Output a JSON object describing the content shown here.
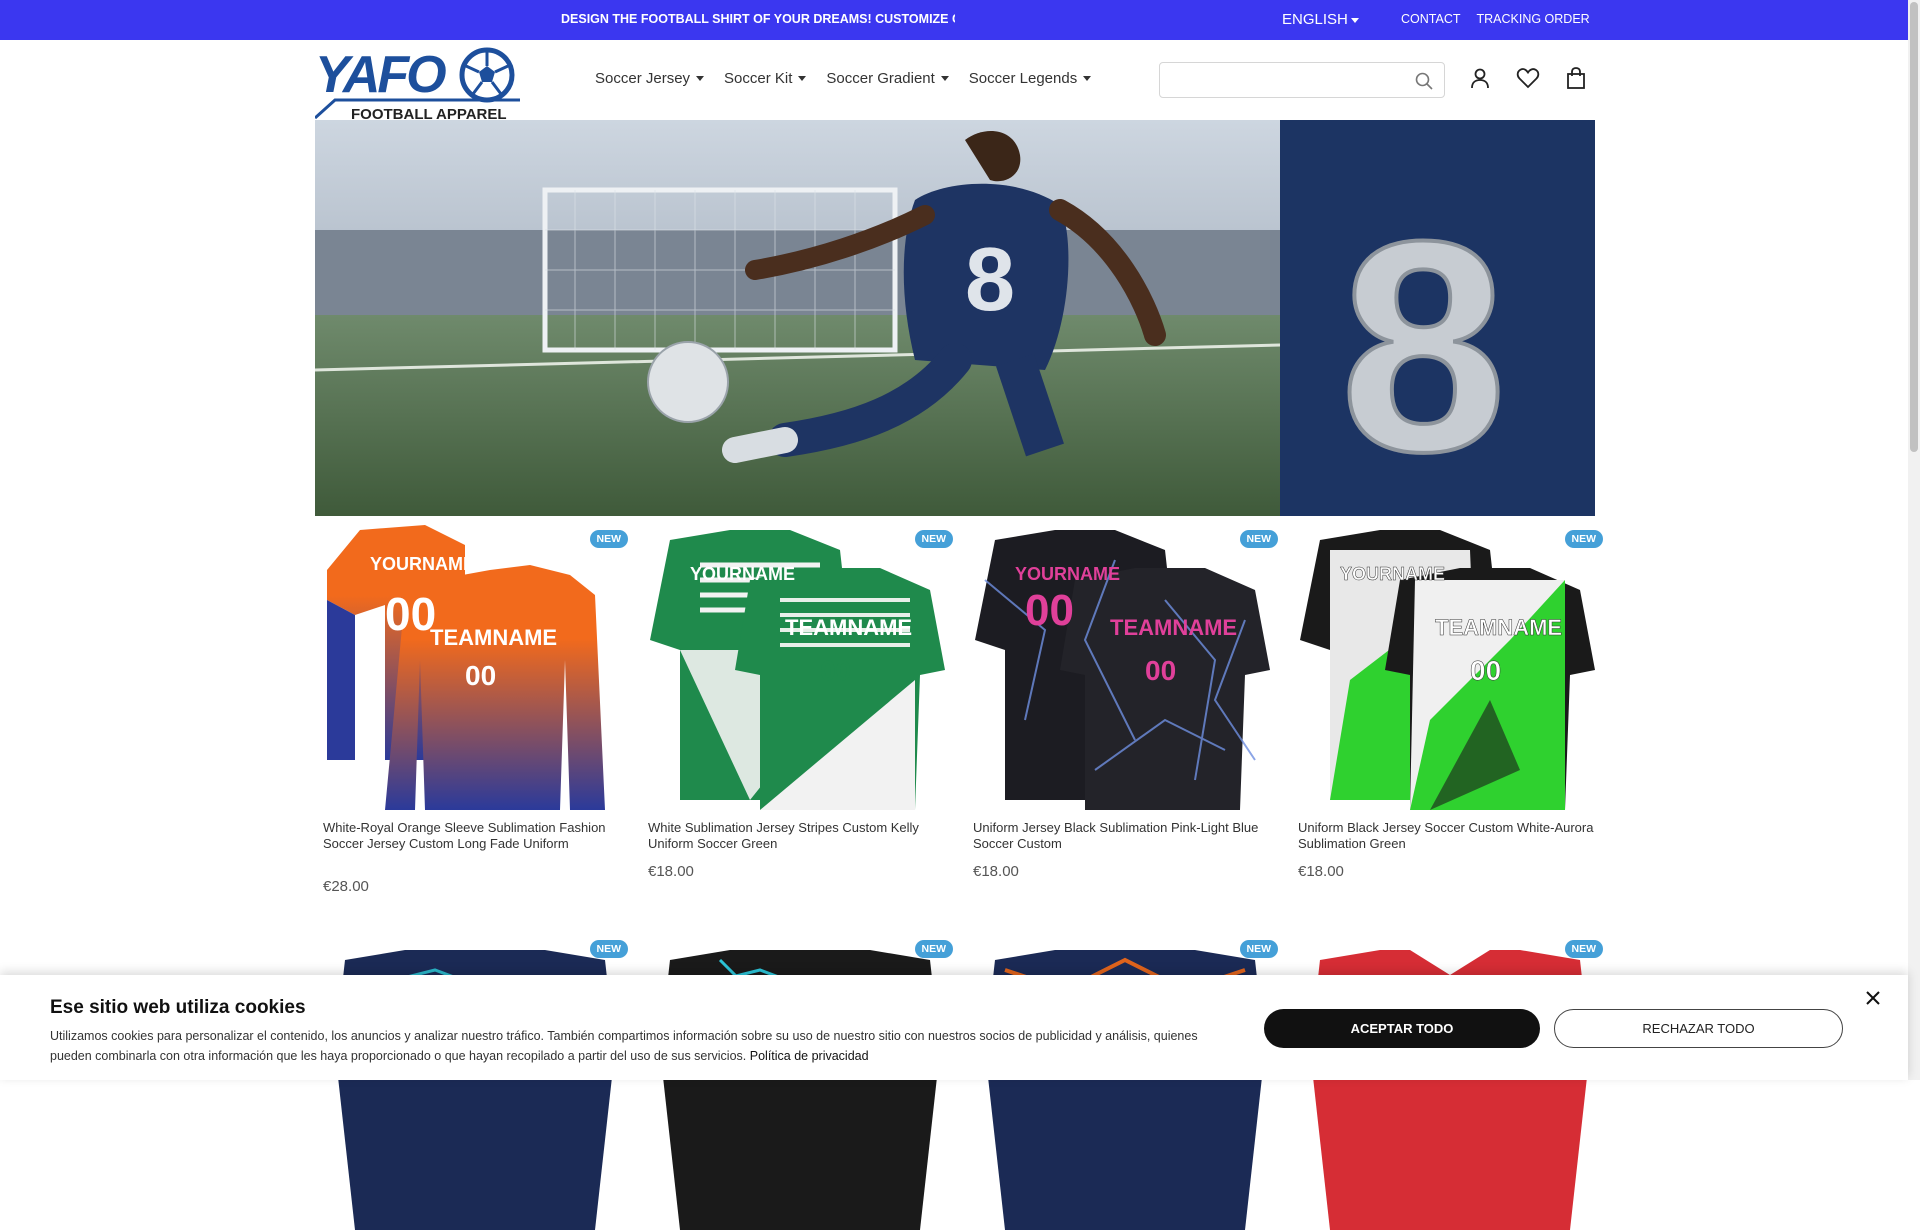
{
  "topbar": {
    "promo": "DESIGN THE FOOTBALL SHIRT OF YOUR DREAMS! CUSTOMIZE COL",
    "language": "ENGLISH",
    "links": [
      "CONTACT",
      "TRACKING ORDER"
    ],
    "color": "#3b37f0"
  },
  "logo": {
    "text_main": "YAFO",
    "text_sub": "FOOTBALL APPAREL"
  },
  "nav": {
    "items": [
      "Soccer Jersey",
      "Soccer Kit",
      "Soccer Gradient",
      "Soccer Legends"
    ]
  },
  "search": {
    "placeholder": "",
    "icon": "search-icon"
  },
  "header_icons": [
    "user-icon",
    "heart-icon",
    "bag-icon"
  ],
  "hero": {
    "jersey_number": "8"
  },
  "products": [
    {
      "badge": "NEW",
      "name": "White-Royal Orange Sleeve Sublimation Fashion Soccer Jersey Custom Long Fade Uniform",
      "price": "€28.00",
      "colors": [
        "#f26a1c",
        "#2b3a9a"
      ],
      "jersey_text": "YOURNAME",
      "team_text": "TEAMNAME",
      "number": "00"
    },
    {
      "badge": "NEW",
      "name": "White Sublimation Jersey Stripes Custom Kelly Uniform Soccer Green",
      "price": "€18.00",
      "colors": [
        "#1f8a4c",
        "#f2f2f2"
      ],
      "jersey_text": "YOURNAME",
      "team_text": "TEAMNAME",
      "number": "00"
    },
    {
      "badge": "NEW",
      "name": "Uniform Jersey Black Sublimation Pink-Light Blue Soccer Custom",
      "price": "€18.00",
      "colors": [
        "#1c1c22",
        "#e0409a"
      ],
      "jersey_text": "YOURNAME",
      "team_text": "TEAMNAME",
      "number": "00"
    },
    {
      "badge": "NEW",
      "name": "Uniform Black Jersey Soccer Custom White-Aurora Sublimation Green",
      "price": "€18.00",
      "colors": [
        "#1a1a1a",
        "#2fd12f"
      ],
      "jersey_text": "YOURNAME",
      "team_text": "TEAMNAME",
      "number": "00"
    },
    {
      "badge": "NEW",
      "colors": [
        "#1b2a55",
        "#2bb6c9"
      ]
    },
    {
      "badge": "NEW",
      "colors": [
        "#1a1a1a",
        "#2cc4d8"
      ]
    },
    {
      "badge": "NEW",
      "colors": [
        "#1b2a55",
        "#e0641c"
      ]
    },
    {
      "badge": "NEW",
      "colors": [
        "#d62d35",
        "#ffffff"
      ]
    }
  ],
  "cookie": {
    "title": "Ese sitio web utiliza cookies",
    "text": "Utilizamos cookies para personalizar el contenido, los anuncios y analizar nuestro tráfico. También compartimos información sobre su uso de nuestro sitio con nuestros socios de publicidad y análisis, quienes pueden combinarla con otra información que les haya proporcionado o que hayan recopilado a partir del uso de sus servicios.",
    "privacy_link": "Política de privacidad",
    "accept": "ACEPTAR TODO",
    "reject": "RECHAZAR TODO"
  }
}
